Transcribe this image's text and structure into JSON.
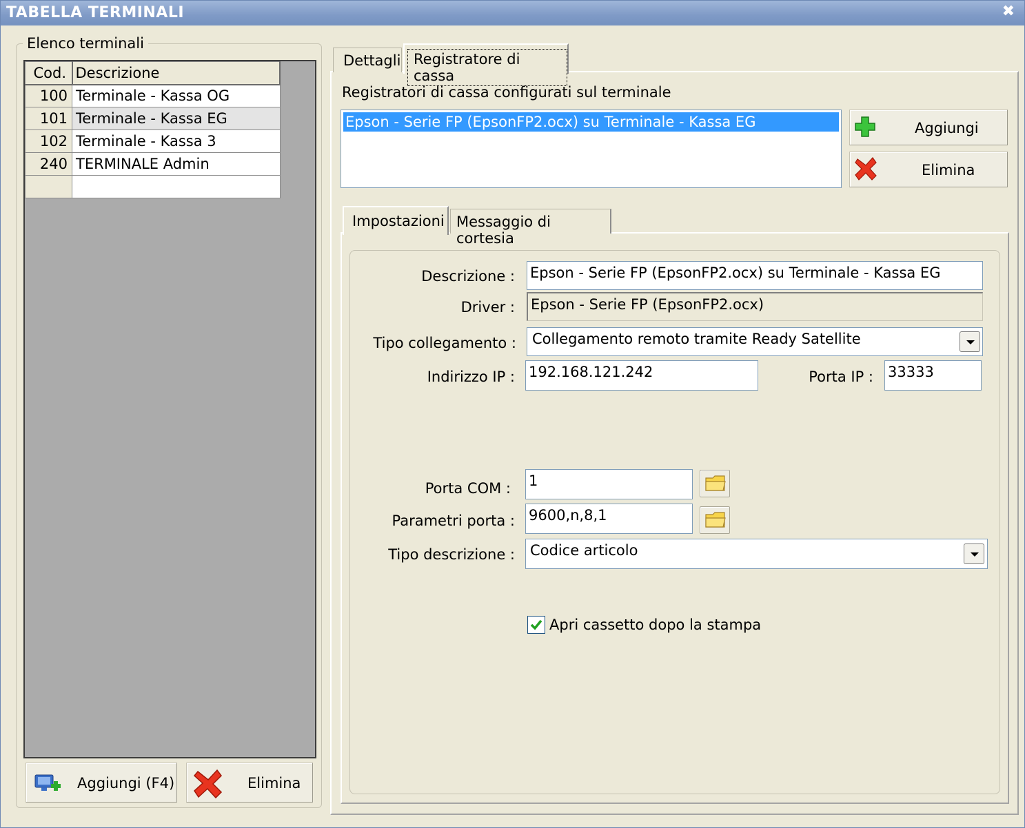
{
  "window": {
    "title": "TABELLA TERMINALI",
    "close_glyph": "✖"
  },
  "left": {
    "group_title": "Elenco terminali",
    "columns": [
      "Cod.",
      "Descrizione"
    ],
    "rows": [
      {
        "cod": "100",
        "desc": "Terminale - Kassa OG"
      },
      {
        "cod": "101",
        "desc": "Terminale - Kassa EG"
      },
      {
        "cod": "102",
        "desc": "Terminale - Kassa 3"
      },
      {
        "cod": "240",
        "desc": "TERMINALE Admin"
      }
    ],
    "add_label": "Aggiungi (F4)",
    "delete_label": "Elimina"
  },
  "tabs": {
    "tab1": "Dettagli",
    "tab2": "Registratore di cassa"
  },
  "register": {
    "list_caption": "Registratori di cassa configurati sul terminale",
    "selected_item": "Epson - Serie FP (EpsonFP2.ocx) su Terminale - Kassa EG",
    "add_label": "Aggiungi",
    "delete_label": "Elimina"
  },
  "subtabs": {
    "tab1": "Impostazioni",
    "tab2": "Messaggio di cortesia"
  },
  "form": {
    "descrizione_label": "Descrizione :",
    "descrizione_value": "Epson - Serie FP (EpsonFP2.ocx) su Terminale - Kassa EG",
    "driver_label": "Driver :",
    "driver_value": "Epson - Serie FP (EpsonFP2.ocx)",
    "tipo_collegamento_label": "Tipo collegamento :",
    "tipo_collegamento_value": "Collegamento remoto tramite Ready Satellite",
    "ip_label": "Indirizzo IP :",
    "ip_value": "192.168.121.242",
    "porta_ip_label": "Porta IP :",
    "porta_ip_value": "33333",
    "com_label": "Porta COM :",
    "com_value": "1",
    "param_label": "Parametri porta :",
    "param_value": "9600,n,8,1",
    "tipo_descr_label": "Tipo descrizione :",
    "tipo_descr_value": "Codice articolo",
    "cassetto_label": "Apri cassetto dopo la stampa",
    "cassetto_checked": true
  },
  "colors": {
    "selection": "#3399ff",
    "title_bar": "#7f9ac6"
  },
  "icons": [
    "close-icon",
    "add-terminal-icon",
    "delete-x-icon",
    "plus-green-icon",
    "folder-icon",
    "checkbox-check-icon",
    "chevron-down-icon"
  ]
}
